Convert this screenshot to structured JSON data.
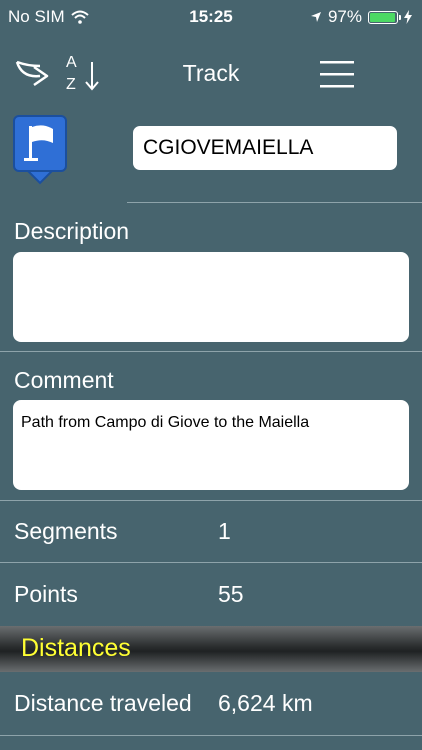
{
  "status_bar": {
    "carrier": "No SIM",
    "time": "15:25",
    "battery": "97%",
    "battery_level": 0.97
  },
  "nav": {
    "title": "Track",
    "share_icon": "share-arrow-icon",
    "sort_icon": "sort-az-icon",
    "menu_icon": "hamburger-menu-icon",
    "sort_letter_a": "A",
    "sort_letter_z": "Z"
  },
  "track": {
    "name": "CGIOVEMAIELLA",
    "flag_icon": "flag-pin-icon"
  },
  "description": {
    "label": "Description",
    "value": ""
  },
  "comment": {
    "label": "Comment",
    "value": "Path from Campo di Giove to the Maiella"
  },
  "stats": {
    "segments_label": "Segments",
    "segments_value": "1",
    "points_label": "Points",
    "points_value": "55"
  },
  "distances": {
    "header": "Distances",
    "traveled_label": "Distance traveled",
    "traveled_value": "6,624 km"
  },
  "colors": {
    "background": "#47646e",
    "accent_header": "#ffff33",
    "battery": "#4cd964",
    "flag_blue": "#2f6fd6"
  }
}
